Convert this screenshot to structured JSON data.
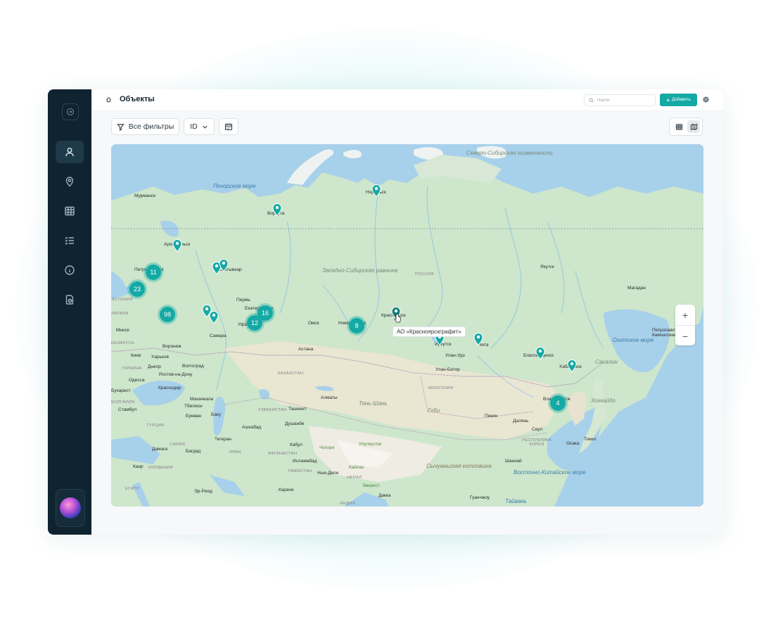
{
  "header": {
    "title": "Объекты",
    "search_placeholder": "Найти",
    "add_label": "Добавить"
  },
  "toolbar": {
    "filters_label": "Все фильтры",
    "id_label": "ID"
  },
  "colors": {
    "accent": "#14a9a4",
    "sidebar_bg": "#0f2330",
    "water": "#a7d0ea"
  },
  "sidebar": {
    "items": [
      {
        "icon": "user-icon",
        "active": true
      },
      {
        "icon": "map-pin-icon"
      },
      {
        "icon": "table-icon"
      },
      {
        "icon": "checklist-icon"
      },
      {
        "icon": "info-icon"
      },
      {
        "icon": "document-clock-icon"
      }
    ]
  },
  "map": {
    "tooltip": "АО «Красноярскграфит»",
    "zoom_in": "+",
    "zoom_out": "−",
    "clusters": [
      "11",
      "23",
      "98",
      "16",
      "12",
      "8",
      "4"
    ],
    "labels": {
      "murmansk": "Мурманск",
      "pechora_sea": "Печорское море",
      "vorkuta": "Воркута",
      "norilsk": "Норильск",
      "siberian_upland": "Северо-Сибирская низменность",
      "arkhangelsk": "Архангельск",
      "petrozavodsk": "Петрозаводск",
      "syktyvkar": "Сыктывкар",
      "west_siberian_plain": "Западно-Сибирская равнина",
      "russia": "РОССИЯ",
      "yakutsk": "Якутск",
      "magadan": "Магадан",
      "estonia": "ЭСТОНИЯ",
      "latvia": "ЛАТВИЯ",
      "perm": "Пермь",
      "ekaterinburg": "Екатеринбург",
      "krasnoyarsk": "Красноярск",
      "minsk": "Минск",
      "ufa": "Уфа",
      "omsk": "Омск",
      "novosibirsk": "Новосибирск",
      "irkutsk": "Иркутск",
      "chita": "Чита",
      "blagoveshchensk": "Благовещенск",
      "khabarovsk": "Хабаровск",
      "petropavlovsk": "Петропавловск-Камчатский",
      "okhotsk_sea": "Охотское море",
      "samara": "Самара",
      "voronezh": "Воронеж",
      "belarus": "БЕЛАРУСЬ",
      "kyiv": "Киев",
      "kharkiv": "Харьков",
      "volgograd": "Волгоград",
      "astana": "Астана",
      "ukraine": "УКРАИНА",
      "dnipro": "Днепр",
      "rostov": "Ростов-на-Дону",
      "kazakhstan": "КАЗАХСТАН",
      "odesa": "Одесса",
      "krasnodar": "Краснодар",
      "ulan_ude": "Улан-Удэ",
      "ulaanbaatar": "Улан-Батор",
      "mongolia": "МОНГОЛИЯ",
      "bucharest": "Бухарест",
      "bulgaria": "БОЛГАРИЯ",
      "makhachkala": "Махачкала",
      "almaty": "Алматы",
      "tianshan": "Тянь-Шань",
      "tbilisi": "Тбилиси",
      "uzbekistan": "УЗБЕКИСТАН",
      "tashkent": "Ташкент",
      "gobi": "Гоби",
      "vladivostok": "Владивосток",
      "istanbul": "Стамбул",
      "yerevan": "Ереван",
      "baku": "Баку",
      "beijing": "Пекин",
      "dalian": "Далянь",
      "turkey": "ТУРЦИЯ",
      "ashgabat": "Ашхабад",
      "dushanbe": "Душанбе",
      "seoul": "Сеул",
      "korea": "РЕСПУБЛИКА КОРЕЯ",
      "tokyo": "Токио",
      "osaka": "Осака",
      "tehran": "Тегеран",
      "damascus": "Дамаск",
      "syria": "СИРИЯ",
      "kabul": "Кабул",
      "afghanistan": "АФГАНИСТАН",
      "baghdad": "Багдад",
      "iran": "ИРАН",
      "chogori": "Чогори",
      "ulugmuztag": "Улугмузтаг",
      "cairo": "Каир",
      "jordan": "ИОРДАНИЯ",
      "kailas": "Кайлас",
      "new_delhi": "Нью-Дели",
      "sichuan_basin": "Сычуаньская котловина",
      "shanghai": "Шанхай",
      "east_china_sea": "Восточно-Китайское море",
      "islamabad": "Исламабад",
      "pakistan": "ПАКИСТАН",
      "nepal": "НЕПАЛ",
      "everest": "Эверест",
      "egypt": "ЕГИПТ",
      "riyadh": "Эр-Рияд",
      "karachi": "Карачи",
      "india": "ИНДИЯ",
      "dhaka": "Дакка",
      "guangzhou": "Гуанчжоу",
      "taiwan": "Тайвань",
      "sakhalin": "Сахалин",
      "hokkaido": "Хоккайдо"
    }
  }
}
